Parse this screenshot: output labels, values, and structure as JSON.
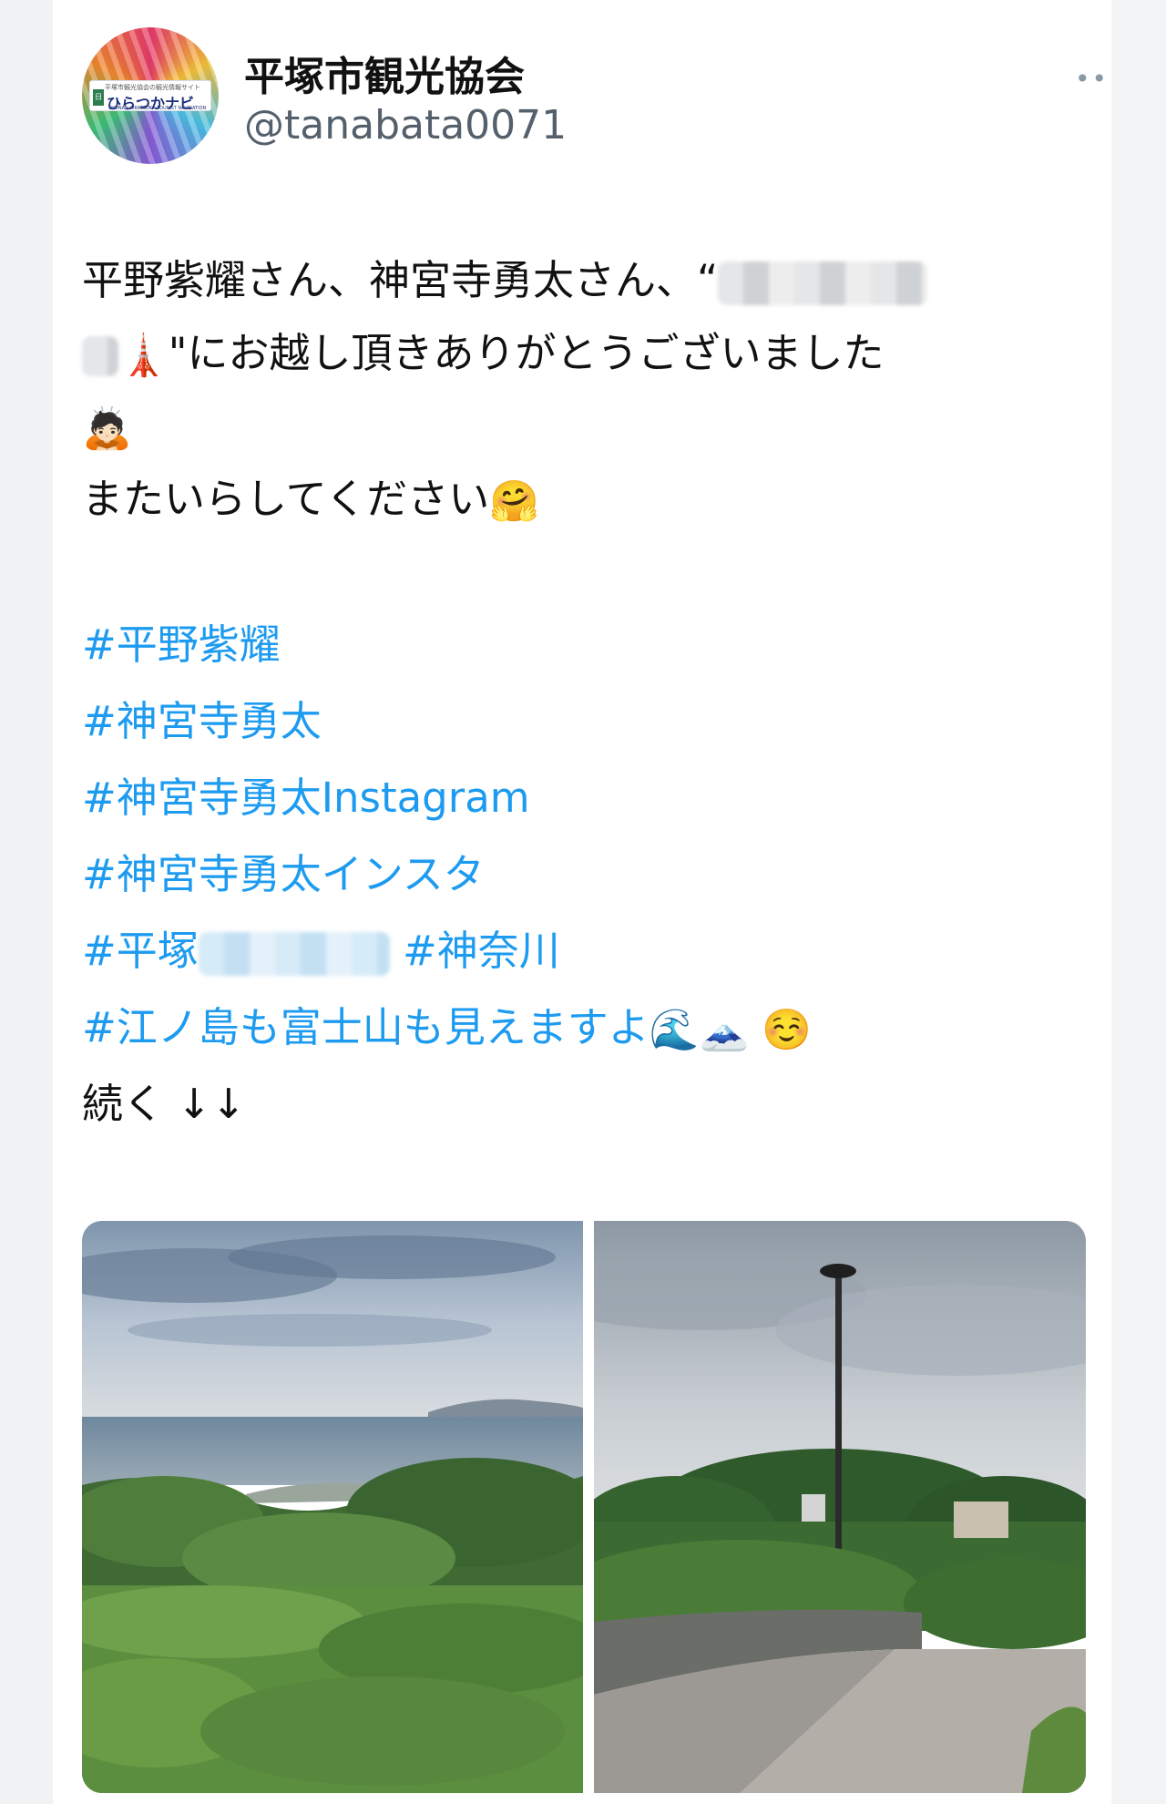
{
  "account": {
    "name": "平塚市観光協会",
    "handle": "@tanabata0071",
    "avatar_text": "ひらつかナビ",
    "avatar_subtext": "平塚市観光協会の観光情報サイト",
    "avatar_en": "SHONAN HIRATSUKA TOURIST NAVIGATION",
    "avatar_flag": "日",
    "more_label": "•••"
  },
  "tweet": {
    "line1_text": "平野紫耀さん、神宮寺勇太さん、",
    "line1_partial": "“",
    "line2_text": "\"にお越し頂きありがとうございました",
    "line3_emoji": "🙇🏻",
    "line4_text": "またいらしてください",
    "line4_emoji": "🤗",
    "hashtags": [
      "#平野紫耀",
      "#神宮寺勇太",
      "#神宮寺勇太Instagram",
      "#神宮寺勇太インスタ"
    ],
    "hashtag_hiratsuka": "#平塚",
    "hashtag_kanagawa": "#神奈川",
    "hashtag_enoshima": "#江ノ島も富士山も見えますよ",
    "enoshima_emojis": "🌊🗻 ☺️",
    "continue_text": "続く ↓↓",
    "tower_emoji": "🗼"
  },
  "colors": {
    "link": "#1d9bf0",
    "text": "#111111",
    "handle": "#54606c"
  },
  "media": [
    "scenic-view-photo",
    "park-path-photo"
  ]
}
